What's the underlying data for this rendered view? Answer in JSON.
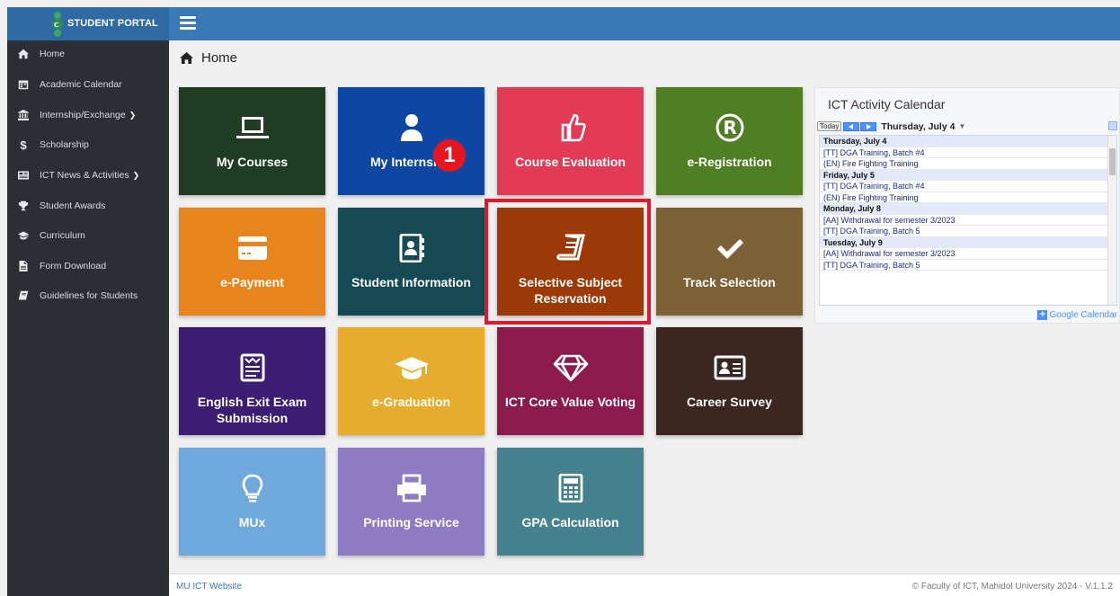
{
  "brand": {
    "name": "STUDENT PORTAL",
    "logo_letters": "ICT"
  },
  "sidebar": {
    "items": [
      {
        "label": "Home",
        "icon": "home-icon"
      },
      {
        "label": "Academic Calendar",
        "icon": "calendar-icon"
      },
      {
        "label": "Internship/Exchange",
        "icon": "institution-icon",
        "has_submenu": true
      },
      {
        "label": "Scholarship",
        "icon": "dollar-icon"
      },
      {
        "label": "ICT News & Activities",
        "icon": "newspaper-icon",
        "has_submenu": true
      },
      {
        "label": "Student Awards",
        "icon": "trophy-icon"
      },
      {
        "label": "Curriculum",
        "icon": "graduation-cap-icon"
      },
      {
        "label": "Form Download",
        "icon": "file-icon"
      },
      {
        "label": "Guidelines for Students",
        "icon": "book-icon"
      }
    ]
  },
  "page": {
    "title": "Home"
  },
  "tiles": [
    {
      "label": "My Courses",
      "icon": "laptop-icon",
      "color": "#1f3d22"
    },
    {
      "label": "My Internship",
      "icon": "user-icon",
      "color": "#0e47a3"
    },
    {
      "label": "Course Evaluation",
      "icon": "thumbs-up-icon",
      "color": "#e33a55"
    },
    {
      "label": "e-Registration",
      "icon": "registered-icon",
      "color": "#4f7e23"
    },
    {
      "label": "e-Payment",
      "icon": "credit-card-icon",
      "color": "#e7851c"
    },
    {
      "label": "Student Information",
      "icon": "address-book-icon",
      "color": "#154a55"
    },
    {
      "label": "Selective Subject Reservation",
      "icon": "book-icon",
      "color": "#9b3a06"
    },
    {
      "label": "Track Selection",
      "icon": "check-icon",
      "color": "#7c6036"
    },
    {
      "label": "English Exit Exam Submission",
      "icon": "newspaper-icon",
      "color": "#3d1d74"
    },
    {
      "label": "e-Graduation",
      "icon": "graduation-cap-icon",
      "color": "#e8ac2c"
    },
    {
      "label": "ICT Core Value Voting",
      "icon": "diamond-icon",
      "color": "#8c1a4c"
    },
    {
      "label": "Career Survey",
      "icon": "id-card-icon",
      "color": "#3c2620"
    },
    {
      "label": "MUx",
      "icon": "lightbulb-icon",
      "color": "#6fa8dc"
    },
    {
      "label": "Printing Service",
      "icon": "printer-icon",
      "color": "#8e7cc3"
    },
    {
      "label": "GPA Calculation",
      "icon": "calculator-icon",
      "color": "#45818e"
    }
  ],
  "annotation": {
    "badge": "1"
  },
  "calendar": {
    "title": "ICT Activity Calendar",
    "today_label": "Today",
    "current_date": "Thursday, July 4",
    "rows": [
      {
        "type": "day",
        "text": "Thursday, July 4"
      },
      {
        "type": "event",
        "text": "[TT] DGA Training, Batch #4"
      },
      {
        "type": "event",
        "text": "(EN) Fire Fighting Training"
      },
      {
        "type": "day",
        "text": "Friday, July 5"
      },
      {
        "type": "event",
        "text": "[TT] DGA Training, Batch #4"
      },
      {
        "type": "event",
        "text": "(EN) Fire Fighting Training"
      },
      {
        "type": "day",
        "text": "Monday, July 8"
      },
      {
        "type": "event",
        "text": "[AA] Withdrawal for semester 3/2023"
      },
      {
        "type": "event",
        "text": "[TT] DGA Training, Batch 5"
      },
      {
        "type": "day",
        "text": "Tuesday, July 9"
      },
      {
        "type": "event",
        "text": "[AA] Withdrawal for semester 3/2023"
      },
      {
        "type": "event",
        "text": "[TT] DGA Training, Batch 5"
      }
    ],
    "google_label": "Google Calendar"
  },
  "footer": {
    "link": "MU ICT Website",
    "copyright": "© Faculty of ICT, Mahidol University 2024 - V.1.1.2"
  }
}
